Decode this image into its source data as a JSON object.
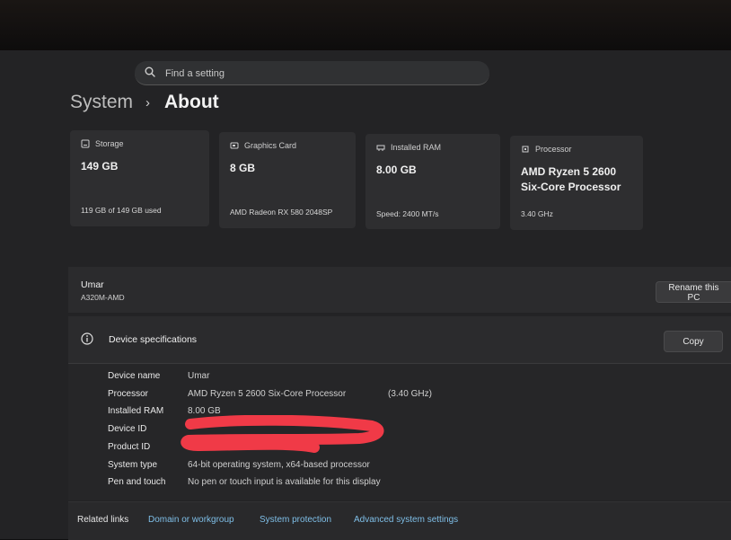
{
  "search": {
    "placeholder": "Find a setting"
  },
  "breadcrumb": {
    "parent": "System",
    "current": "About"
  },
  "cards": [
    {
      "label": "Storage",
      "value": "149 GB",
      "sub": "119 GB of 149 GB used"
    },
    {
      "label": "Graphics Card",
      "value": "8 GB",
      "sub": "AMD Radeon RX 580 2048SP"
    },
    {
      "label": "Installed RAM",
      "value": "8.00 GB",
      "sub": "Speed: 2400 MT/s"
    },
    {
      "label": "Processor",
      "value_line1": "AMD Ryzen 5 2600",
      "value_line2": "Six-Core Processor",
      "sub": "3.40 GHz"
    }
  ],
  "pc": {
    "name": "Umar",
    "model": "A320M-AMD",
    "rename_label": "Rename this PC"
  },
  "device_specs": {
    "title": "Device specifications",
    "copy_label": "Copy",
    "rows": [
      {
        "key": "Device name",
        "value": "Umar"
      },
      {
        "key": "Processor",
        "value": "AMD Ryzen 5 2600 Six-Core Processor",
        "extra": "(3.40 GHz)"
      },
      {
        "key": "Installed RAM",
        "value": "8.00 GB"
      },
      {
        "key": "Device ID",
        "value": ""
      },
      {
        "key": "Product ID",
        "value": ""
      },
      {
        "key": "System type",
        "value": "64-bit operating system, x64-based processor"
      },
      {
        "key": "Pen and touch",
        "value": "No pen or touch input is available for this display"
      }
    ]
  },
  "related": {
    "label": "Related links",
    "links": [
      "Domain or workgroup",
      "System protection",
      "Advanced system settings"
    ]
  },
  "colors": {
    "redaction": "#f03a47",
    "link": "#7fbfe8",
    "card_bg": "#2e2e30"
  }
}
